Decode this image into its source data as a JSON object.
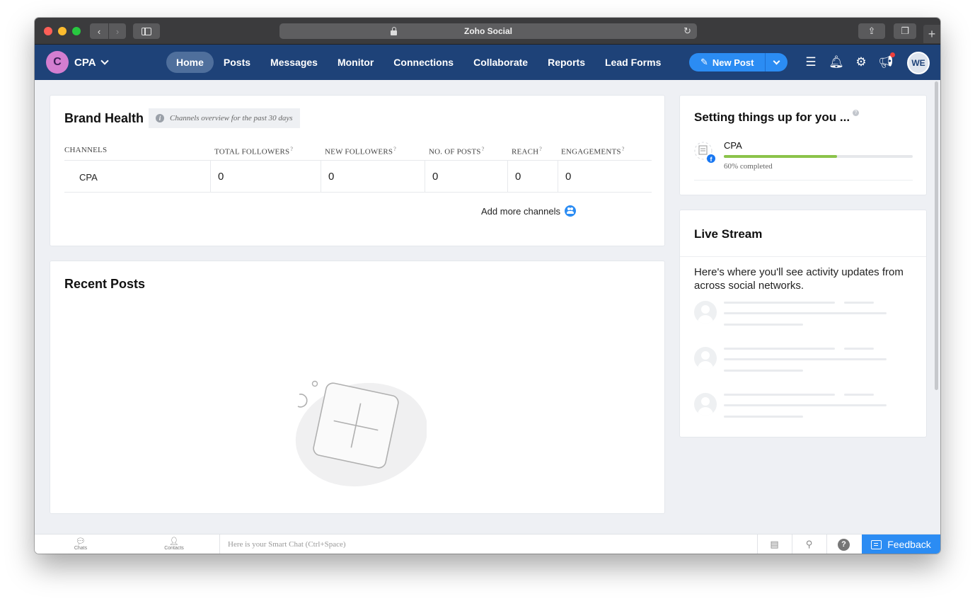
{
  "browser": {
    "title": "Zoho Social"
  },
  "nav": {
    "brand_initial": "C",
    "brand_name": "CPA",
    "items": [
      {
        "label": "Home",
        "active": true
      },
      {
        "label": "Posts"
      },
      {
        "label": "Messages"
      },
      {
        "label": "Monitor"
      },
      {
        "label": "Connections"
      },
      {
        "label": "Collaborate"
      },
      {
        "label": "Reports"
      },
      {
        "label": "Lead Forms"
      }
    ],
    "new_post_label": "New Post",
    "user_initials": "WE",
    "icons": [
      "menu-icon",
      "bell-icon",
      "gear-icon",
      "megaphone-icon"
    ]
  },
  "brand_health": {
    "title": "Brand Health",
    "subtitle": "Channels overview for the past 30 days",
    "columns": [
      "CHANNELS",
      "TOTAL FOLLOWERS",
      "NEW FOLLOWERS",
      "NO. OF POSTS",
      "REACH",
      "ENGAGEMENTS"
    ],
    "help_mark": "?",
    "rows": [
      {
        "channel": "CPA",
        "total_followers": "0",
        "new_followers": "0",
        "posts": "0",
        "reach": "0",
        "engagements": "0"
      }
    ],
    "add_channels_label": "Add more channels"
  },
  "recent_posts": {
    "title": "Recent Posts"
  },
  "setup": {
    "title": "Setting things up for you ...",
    "channel_name": "CPA",
    "progress": 0.6,
    "progress_label": "60% completed",
    "accent": "#8bc34a"
  },
  "live_stream": {
    "title": "Live Stream",
    "description": "Here's where you'll see activity updates from across social networks."
  },
  "bottom_bar": {
    "chats_label": "Chats",
    "contacts_label": "Contacts",
    "smart_chat_placeholder": "Here is your Smart Chat (Ctrl+Space)",
    "feedback_label": "Feedback"
  },
  "colors": {
    "nav_bg": "#1e4278",
    "primary": "#2b8cf3",
    "notification": "#f0403d"
  }
}
